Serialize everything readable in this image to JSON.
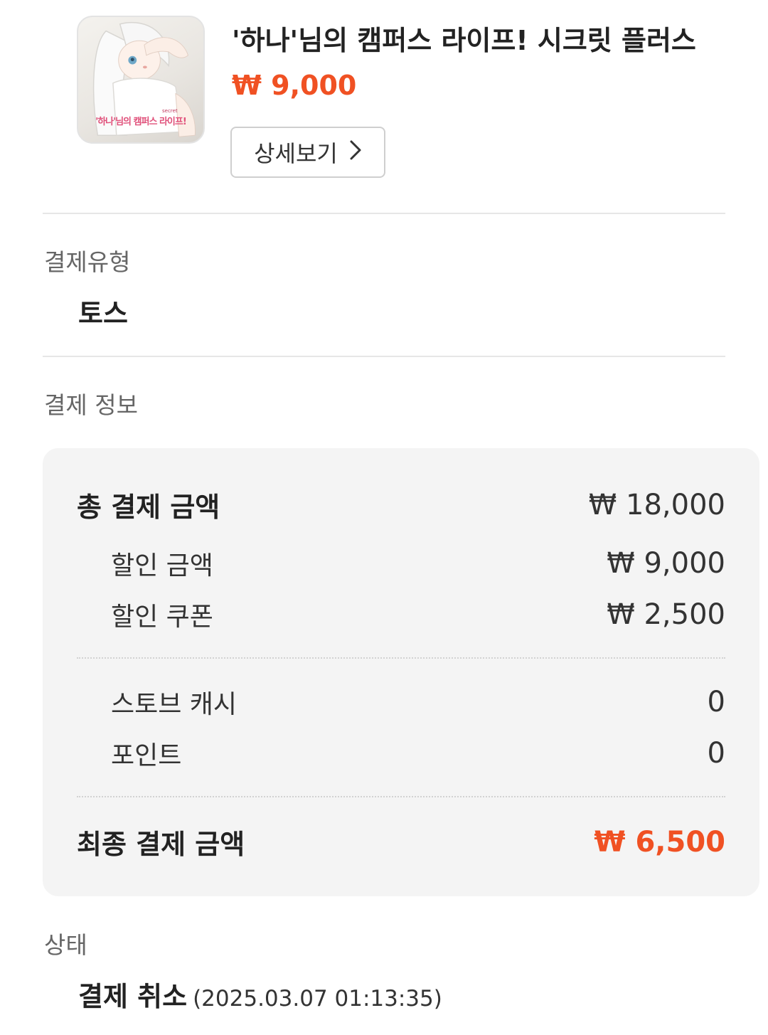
{
  "product": {
    "title": "'하나'님의 캠퍼스 라이프! 시크릿 플러스",
    "price": "₩ 9,000",
    "thumbnail_caption": "'하나'님의 캠퍼스 라이프!",
    "thumbnail_small": "secret",
    "detail_button": "상세보기",
    "accent_color": "#f05123"
  },
  "payment_type": {
    "label": "결제유형",
    "value": "토스"
  },
  "payment_info": {
    "label": "결제 정보",
    "total_label": "총 결제 금액",
    "total_value": "₩ 18,000",
    "discount_label": "할인 금액",
    "discount_value": "₩ 9,000",
    "coupon_label": "할인 쿠폰",
    "coupon_value": "₩ 2,500",
    "cash_label": "스토브 캐시",
    "cash_value": "0",
    "point_label": "포인트",
    "point_value": "0",
    "final_label": "최종 결제 금액",
    "final_value": "₩ 6,500"
  },
  "status": {
    "label": "상태",
    "value": "결제 취소",
    "datetime": "(2025.03.07 01:13:35)"
  }
}
